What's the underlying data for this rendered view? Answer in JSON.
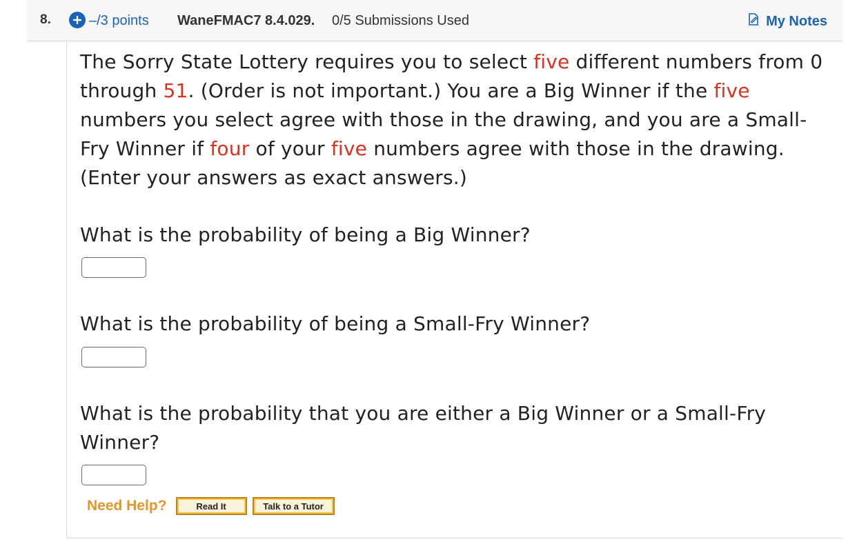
{
  "header": {
    "question_number": "8.",
    "points": "–/3 points",
    "question_ref": "WaneFMAC7 8.4.029.",
    "submissions": "0/5 Submissions Used",
    "notes_label": "My Notes"
  },
  "problem": {
    "parts": [
      "The Sorry State Lottery requires you to select ",
      "five",
      " different numbers from 0 through ",
      "51",
      ". (Order is not important.) You are a Big Winner if the ",
      "five",
      " numbers you select agree with those in the drawing, and you are a Small-Fry Winner if ",
      "four",
      " of your ",
      "five",
      " numbers agree with those in the drawing. (Enter your answers as exact answers.)"
    ]
  },
  "questions": [
    {
      "text": "What is the probability of being a Big Winner?",
      "answer": ""
    },
    {
      "text": "What is the probability of being a Small-Fry Winner?",
      "answer": ""
    },
    {
      "text": "What is the probability that you are either a Big Winner or a Small-Fry Winner?",
      "answer": ""
    }
  ],
  "help": {
    "label": "Need Help?",
    "read_it": "Read It",
    "tutor": "Talk to a Tutor"
  },
  "colors": {
    "accent_blue": "#1a63b8",
    "highlight_red": "#d9321f",
    "help_orange": "#e2962b"
  }
}
